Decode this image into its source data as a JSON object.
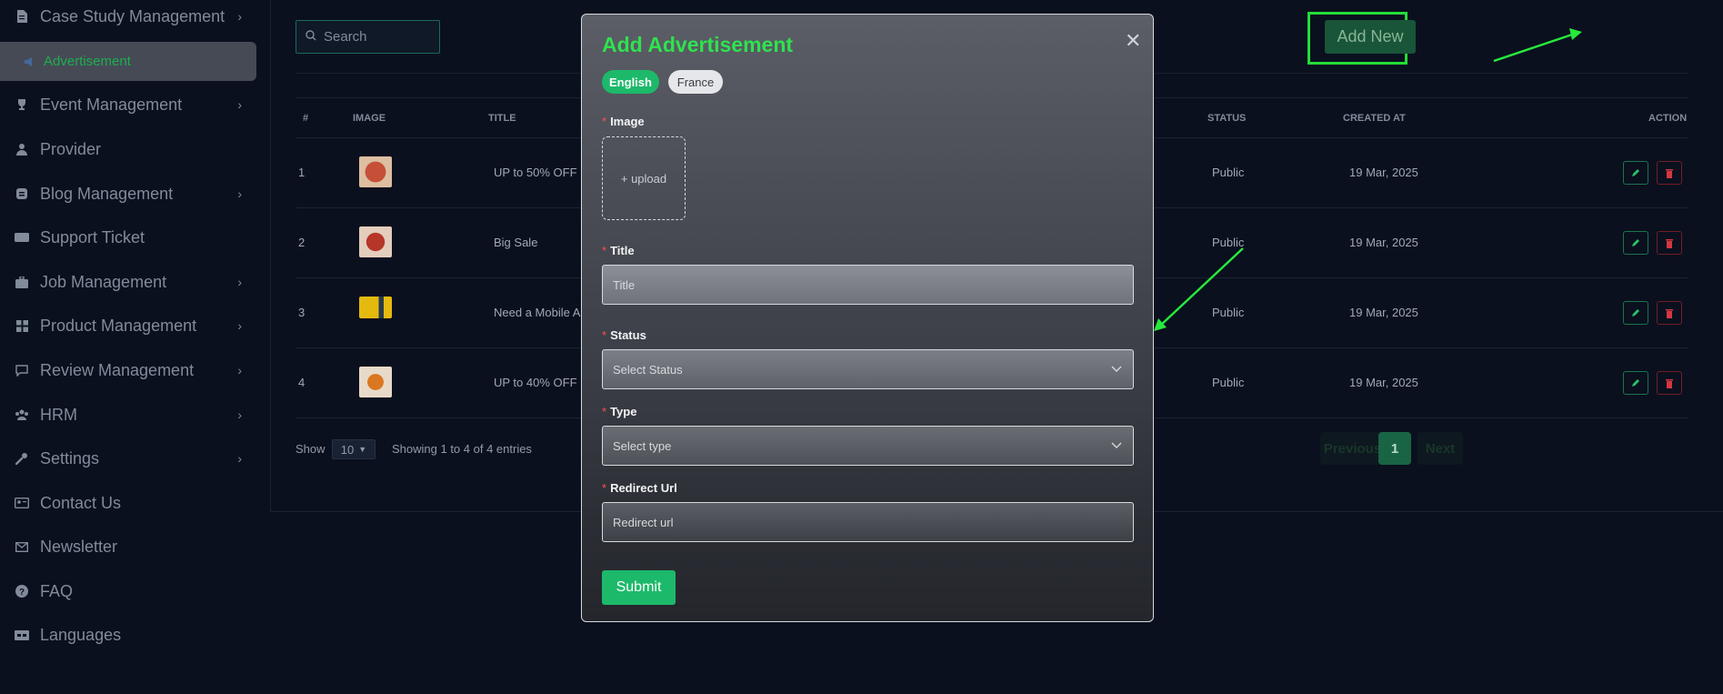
{
  "sidebar": {
    "items": [
      {
        "label": "Case Study Management",
        "icon": "document-icon",
        "has_chevron": true
      },
      {
        "label": "Advertisement",
        "icon": "megaphone-icon",
        "active": true
      },
      {
        "label": "Event Management",
        "icon": "trophy-icon",
        "has_chevron": true
      },
      {
        "label": "Provider",
        "icon": "user-icon"
      },
      {
        "label": "Blog Management",
        "icon": "blog-icon",
        "has_chevron": true
      },
      {
        "label": "Support Ticket",
        "icon": "keyboard-icon"
      },
      {
        "label": "Job Management",
        "icon": "briefcase-icon",
        "has_chevron": true
      },
      {
        "label": "Product Management",
        "icon": "grid-icon",
        "has_chevron": true
      },
      {
        "label": "Review Management",
        "icon": "chat-icon",
        "has_chevron": true
      },
      {
        "label": "HRM",
        "icon": "team-icon",
        "has_chevron": true
      },
      {
        "label": "Settings",
        "icon": "wrench-icon",
        "has_chevron": true
      },
      {
        "label": "Contact Us",
        "icon": "contact-card-icon"
      },
      {
        "label": "Newsletter",
        "icon": "mail-icon"
      },
      {
        "label": "FAQ",
        "icon": "question-icon"
      },
      {
        "label": "Languages",
        "icon": "language-icon"
      }
    ]
  },
  "toolbar": {
    "search_placeholder": "Search",
    "add_new_label": "Add New"
  },
  "table": {
    "headers": [
      "#",
      "IMAGE",
      "TITLE",
      "STATUS",
      "CREATED AT",
      "ACTION"
    ],
    "rows": [
      {
        "index": "1",
        "title": "UP to 50% OFF",
        "status": "Public",
        "created_at": "19 Mar, 2025"
      },
      {
        "index": "2",
        "title": "Big Sale",
        "status": "Public",
        "created_at": "19 Mar, 2025"
      },
      {
        "index": "3",
        "title": "Need a Mobile A",
        "status": "Public",
        "created_at": "19 Mar, 2025"
      },
      {
        "index": "4",
        "title": "UP to 40% OFF",
        "status": "Public",
        "created_at": "19 Mar, 2025"
      }
    ]
  },
  "footer": {
    "show_label": "Show",
    "page_size": "10",
    "entries_text": "Showing 1 to 4 of 4 entries",
    "previous_label": "Previous",
    "current_page": "1",
    "next_label": "Next"
  },
  "modal": {
    "title": "Add Advertisement",
    "languages": [
      "English",
      "France"
    ],
    "image_label": "Image",
    "upload_label": "+ upload",
    "title_label": "Title",
    "title_placeholder": "Title",
    "status_label": "Status",
    "status_placeholder": "Select Status",
    "type_label": "Type",
    "type_placeholder": "Select type",
    "url_label": "Redirect Url",
    "url_placeholder": "Redirect url",
    "submit_label": "Submit",
    "required_mark": "*"
  },
  "colors": {
    "accent_green": "#1db96a",
    "title_green": "#2fe24f",
    "annotation_green": "#27e83c",
    "danger_red": "#ff4d4f"
  }
}
